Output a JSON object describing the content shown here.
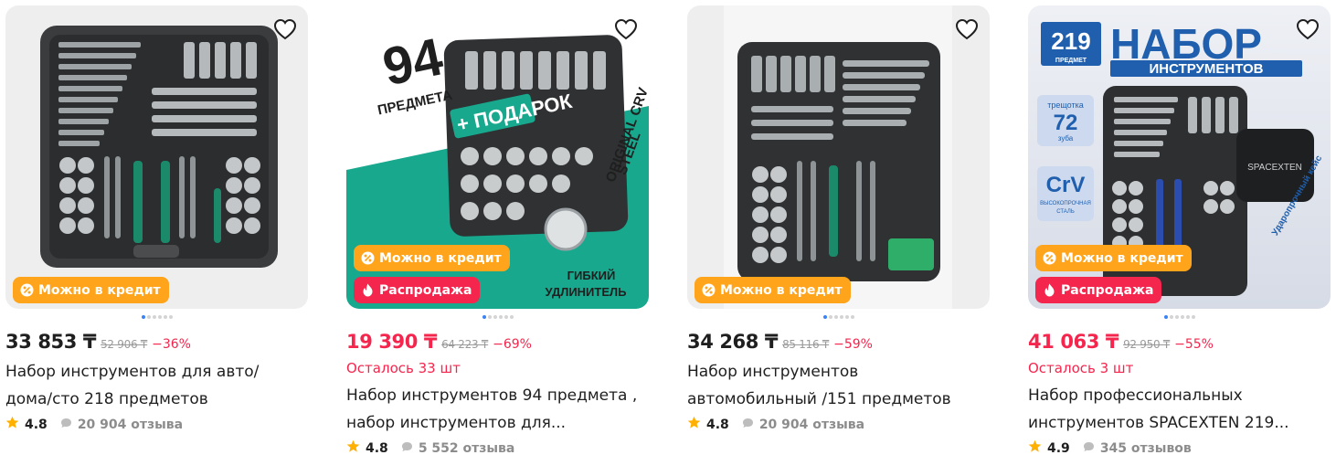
{
  "colors": {
    "accent_red": "#f5264e",
    "credit_orange": "#ffa41b",
    "star": "#ffb000",
    "dot_active": "#3b82f6"
  },
  "products": [
    {
      "price": "33 853 ₸",
      "old_price": "52 906 ₸",
      "discount": "−36%",
      "stock_left": "",
      "title_line1": "Набор инструментов для авто/",
      "title_line2": "дома/сто 218 предметов",
      "rating": "4.8",
      "reviews": "20 904 отзыва",
      "badge_credit": "Можно в кредит",
      "badge_sale": "",
      "image_text": []
    },
    {
      "price": "19 390 ₸",
      "old_price": "64 223 ₸",
      "discount": "−69%",
      "stock_left": "Осталось 33 шт",
      "title_line1": "Набор инструментов 94 предмета ,",
      "title_line2": "набор инструментов для...",
      "rating": "4.8",
      "reviews": "5 552 отзыва",
      "badge_credit": "Можно в кредит",
      "badge_sale": "Распродажа",
      "image_text": [
        "94",
        "ПРЕДМЕТА",
        "+ ПОДАРОК",
        "ORIGINAL CRV",
        "STEEL",
        "ГИБКИЙ",
        "УДЛИНИТЕЛЬ"
      ]
    },
    {
      "price": "34 268 ₸",
      "old_price": "85 116 ₸",
      "discount": "−59%",
      "stock_left": "",
      "title_line1": "Набор инструментов",
      "title_line2": "автомобильный /151 предметов",
      "rating": "4.8",
      "reviews": "20 904 отзыва",
      "badge_credit": "Можно в кредит",
      "badge_sale": "",
      "image_text": []
    },
    {
      "price": "41 063 ₸",
      "old_price": "92 950 ₸",
      "discount": "−55%",
      "stock_left": "Осталось 3 шт",
      "title_line1": "Набор профессиональных",
      "title_line2": "инструментов SPACEXTEN 219...",
      "rating": "4.9",
      "reviews": "345 отзывов",
      "badge_credit": "Можно в кредит",
      "badge_sale": "Распродажа",
      "image_text": [
        "219",
        "ПРЕДМЕТ",
        "НАБОР",
        "ИНСТРУМЕНТОВ",
        "трещотка",
        "72",
        "зуба",
        "CrV",
        "ВЫСОКОПРОЧНАЯ",
        "СТАЛЬ",
        "SPACEXTEN",
        "Ударопрочный кейс"
      ]
    }
  ]
}
